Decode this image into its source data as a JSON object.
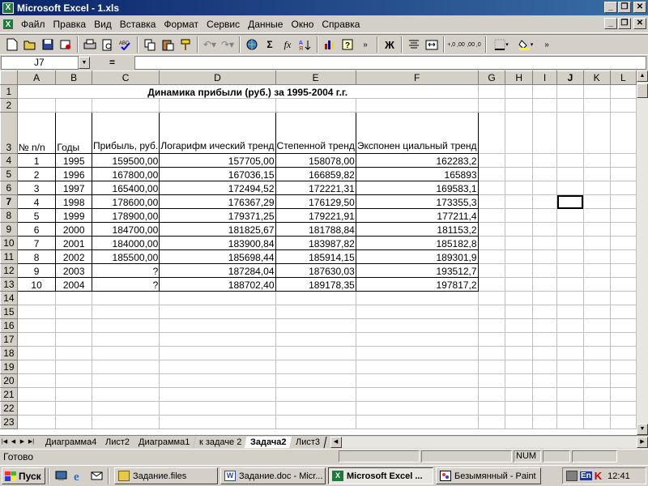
{
  "window": {
    "title": "Microsoft Excel - 1.xls",
    "logo_letter": "X",
    "controls": [
      "_",
      "❐",
      "✕"
    ]
  },
  "menu": {
    "items": [
      "Файл",
      "Правка",
      "Вид",
      "Вставка",
      "Формат",
      "Сервис",
      "Данные",
      "Окно",
      "Справка"
    ],
    "doc_controls": [
      "_",
      "❐",
      "✕"
    ]
  },
  "toolbar": {
    "buttons": [
      "new-icon",
      "open-icon",
      "save-icon",
      "permission-icon",
      "print-icon",
      "print-preview-icon",
      "spelling-icon",
      "copy-icon",
      "paste-icon",
      "format-painter-icon",
      "undo-icon",
      "redo-icon",
      "hyperlink-icon",
      "autosum-icon",
      "function-icon",
      "sort-asc-icon",
      "chart-wizard-icon",
      "help-icon",
      "bold-icon",
      "align-center-icon",
      "merge-icon",
      "inc-decimal-icon",
      "dec-decimal-icon",
      "borders-icon",
      "fill-color-icon"
    ],
    "labels": {
      "sum": "Σ",
      "fx": "fx",
      "bold": "Ж",
      "inc_decimal": "+,0 ,00",
      "dec_decimal": ",00 ,0"
    }
  },
  "formula_bar": {
    "name_box": "J7",
    "equals": "=",
    "value": ""
  },
  "columns": [
    "A",
    "B",
    "C",
    "D",
    "E",
    "F",
    "G",
    "H",
    "I",
    "J",
    "K",
    "L"
  ],
  "active_cell": {
    "column": "J",
    "row": 7
  },
  "sheet": {
    "title": "Динамика прибыли (руб.) за 1995-2004 г.г.",
    "headers": {
      "a": "№ n/n",
      "b": "Годы",
      "c": "Прибыль, руб.",
      "d": "Логарифм ический тренд",
      "e": "Степенной тренд",
      "f": "Экспонен циальный тренд"
    },
    "rows": [
      [
        "1",
        "1995",
        "159500,00",
        "157705,00",
        "158078,00",
        "162283,2"
      ],
      [
        "2",
        "1996",
        "167800,00",
        "167036,15",
        "166859,82",
        "165893"
      ],
      [
        "3",
        "1997",
        "165400,00",
        "172494,52",
        "172221,31",
        "169583,1"
      ],
      [
        "4",
        "1998",
        "178600,00",
        "176367,29",
        "176129,50",
        "173355,3"
      ],
      [
        "5",
        "1999",
        "178900,00",
        "179371,25",
        "179221,91",
        "177211,4"
      ],
      [
        "6",
        "2000",
        "184700,00",
        "181825,67",
        "181788,84",
        "181153,2"
      ],
      [
        "7",
        "2001",
        "184000,00",
        "183900,84",
        "183987,82",
        "185182,8"
      ],
      [
        "8",
        "2002",
        "185500,00",
        "185698,44",
        "185914,15",
        "189301,9"
      ],
      [
        "9",
        "2003",
        "?",
        "187284,04",
        "187630,03",
        "193512,7"
      ],
      [
        "10",
        "2004",
        "?",
        "188702,40",
        "189178,35",
        "197817,2"
      ]
    ],
    "row_numbers": [
      "1",
      "2",
      "3",
      "4",
      "5",
      "6",
      "7",
      "8",
      "9",
      "10",
      "11",
      "12",
      "13",
      "14",
      "15",
      "16",
      "17",
      "18",
      "19",
      "20",
      "21",
      "22",
      "23"
    ]
  },
  "tabs": {
    "nav": [
      "|◀",
      "◀",
      "▶",
      "▶|"
    ],
    "sheets": [
      "Диаграмма4",
      "Лист2",
      "Диаграмма1",
      "к задаче 2",
      "Задача2",
      "Лист3"
    ],
    "active": "Задача2"
  },
  "status": {
    "ready": "Готово",
    "num": "NUM"
  },
  "taskbar": {
    "start": "Пуск",
    "tasks": [
      "Задание.files",
      "Задание.doc - Micr...",
      "Microsoft Excel ...",
      "Безымянный - Paint"
    ],
    "active_task": "Microsoft Excel ...",
    "lang": "En",
    "clock": "12:41"
  }
}
